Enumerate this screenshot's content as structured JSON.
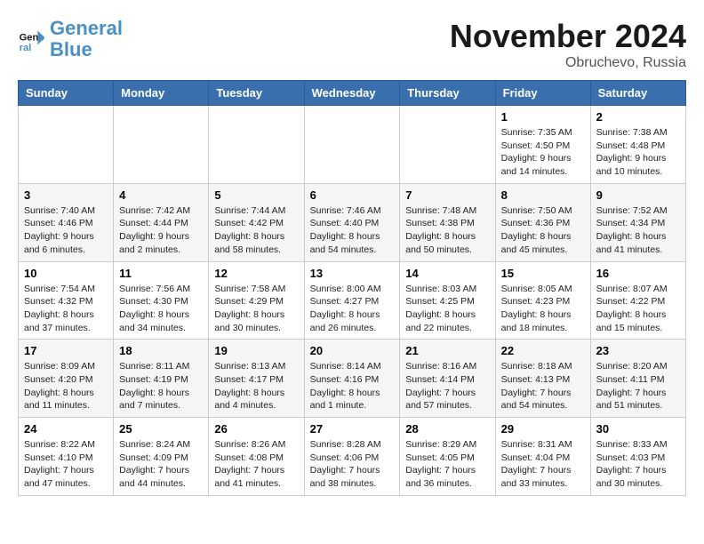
{
  "logo": {
    "line1": "General",
    "line2": "Blue"
  },
  "title": "November 2024",
  "location": "Obruchevo, Russia",
  "weekdays": [
    "Sunday",
    "Monday",
    "Tuesday",
    "Wednesday",
    "Thursday",
    "Friday",
    "Saturday"
  ],
  "weeks": [
    [
      {
        "day": "",
        "info": ""
      },
      {
        "day": "",
        "info": ""
      },
      {
        "day": "",
        "info": ""
      },
      {
        "day": "",
        "info": ""
      },
      {
        "day": "",
        "info": ""
      },
      {
        "day": "1",
        "info": "Sunrise: 7:35 AM\nSunset: 4:50 PM\nDaylight: 9 hours\nand 14 minutes."
      },
      {
        "day": "2",
        "info": "Sunrise: 7:38 AM\nSunset: 4:48 PM\nDaylight: 9 hours\nand 10 minutes."
      }
    ],
    [
      {
        "day": "3",
        "info": "Sunrise: 7:40 AM\nSunset: 4:46 PM\nDaylight: 9 hours\nand 6 minutes."
      },
      {
        "day": "4",
        "info": "Sunrise: 7:42 AM\nSunset: 4:44 PM\nDaylight: 9 hours\nand 2 minutes."
      },
      {
        "day": "5",
        "info": "Sunrise: 7:44 AM\nSunset: 4:42 PM\nDaylight: 8 hours\nand 58 minutes."
      },
      {
        "day": "6",
        "info": "Sunrise: 7:46 AM\nSunset: 4:40 PM\nDaylight: 8 hours\nand 54 minutes."
      },
      {
        "day": "7",
        "info": "Sunrise: 7:48 AM\nSunset: 4:38 PM\nDaylight: 8 hours\nand 50 minutes."
      },
      {
        "day": "8",
        "info": "Sunrise: 7:50 AM\nSunset: 4:36 PM\nDaylight: 8 hours\nand 45 minutes."
      },
      {
        "day": "9",
        "info": "Sunrise: 7:52 AM\nSunset: 4:34 PM\nDaylight: 8 hours\nand 41 minutes."
      }
    ],
    [
      {
        "day": "10",
        "info": "Sunrise: 7:54 AM\nSunset: 4:32 PM\nDaylight: 8 hours\nand 37 minutes."
      },
      {
        "day": "11",
        "info": "Sunrise: 7:56 AM\nSunset: 4:30 PM\nDaylight: 8 hours\nand 34 minutes."
      },
      {
        "day": "12",
        "info": "Sunrise: 7:58 AM\nSunset: 4:29 PM\nDaylight: 8 hours\nand 30 minutes."
      },
      {
        "day": "13",
        "info": "Sunrise: 8:00 AM\nSunset: 4:27 PM\nDaylight: 8 hours\nand 26 minutes."
      },
      {
        "day": "14",
        "info": "Sunrise: 8:03 AM\nSunset: 4:25 PM\nDaylight: 8 hours\nand 22 minutes."
      },
      {
        "day": "15",
        "info": "Sunrise: 8:05 AM\nSunset: 4:23 PM\nDaylight: 8 hours\nand 18 minutes."
      },
      {
        "day": "16",
        "info": "Sunrise: 8:07 AM\nSunset: 4:22 PM\nDaylight: 8 hours\nand 15 minutes."
      }
    ],
    [
      {
        "day": "17",
        "info": "Sunrise: 8:09 AM\nSunset: 4:20 PM\nDaylight: 8 hours\nand 11 minutes."
      },
      {
        "day": "18",
        "info": "Sunrise: 8:11 AM\nSunset: 4:19 PM\nDaylight: 8 hours\nand 7 minutes."
      },
      {
        "day": "19",
        "info": "Sunrise: 8:13 AM\nSunset: 4:17 PM\nDaylight: 8 hours\nand 4 minutes."
      },
      {
        "day": "20",
        "info": "Sunrise: 8:14 AM\nSunset: 4:16 PM\nDaylight: 8 hours\nand 1 minute."
      },
      {
        "day": "21",
        "info": "Sunrise: 8:16 AM\nSunset: 4:14 PM\nDaylight: 7 hours\nand 57 minutes."
      },
      {
        "day": "22",
        "info": "Sunrise: 8:18 AM\nSunset: 4:13 PM\nDaylight: 7 hours\nand 54 minutes."
      },
      {
        "day": "23",
        "info": "Sunrise: 8:20 AM\nSunset: 4:11 PM\nDaylight: 7 hours\nand 51 minutes."
      }
    ],
    [
      {
        "day": "24",
        "info": "Sunrise: 8:22 AM\nSunset: 4:10 PM\nDaylight: 7 hours\nand 47 minutes."
      },
      {
        "day": "25",
        "info": "Sunrise: 8:24 AM\nSunset: 4:09 PM\nDaylight: 7 hours\nand 44 minutes."
      },
      {
        "day": "26",
        "info": "Sunrise: 8:26 AM\nSunset: 4:08 PM\nDaylight: 7 hours\nand 41 minutes."
      },
      {
        "day": "27",
        "info": "Sunrise: 8:28 AM\nSunset: 4:06 PM\nDaylight: 7 hours\nand 38 minutes."
      },
      {
        "day": "28",
        "info": "Sunrise: 8:29 AM\nSunset: 4:05 PM\nDaylight: 7 hours\nand 36 minutes."
      },
      {
        "day": "29",
        "info": "Sunrise: 8:31 AM\nSunset: 4:04 PM\nDaylight: 7 hours\nand 33 minutes."
      },
      {
        "day": "30",
        "info": "Sunrise: 8:33 AM\nSunset: 4:03 PM\nDaylight: 7 hours\nand 30 minutes."
      }
    ]
  ]
}
